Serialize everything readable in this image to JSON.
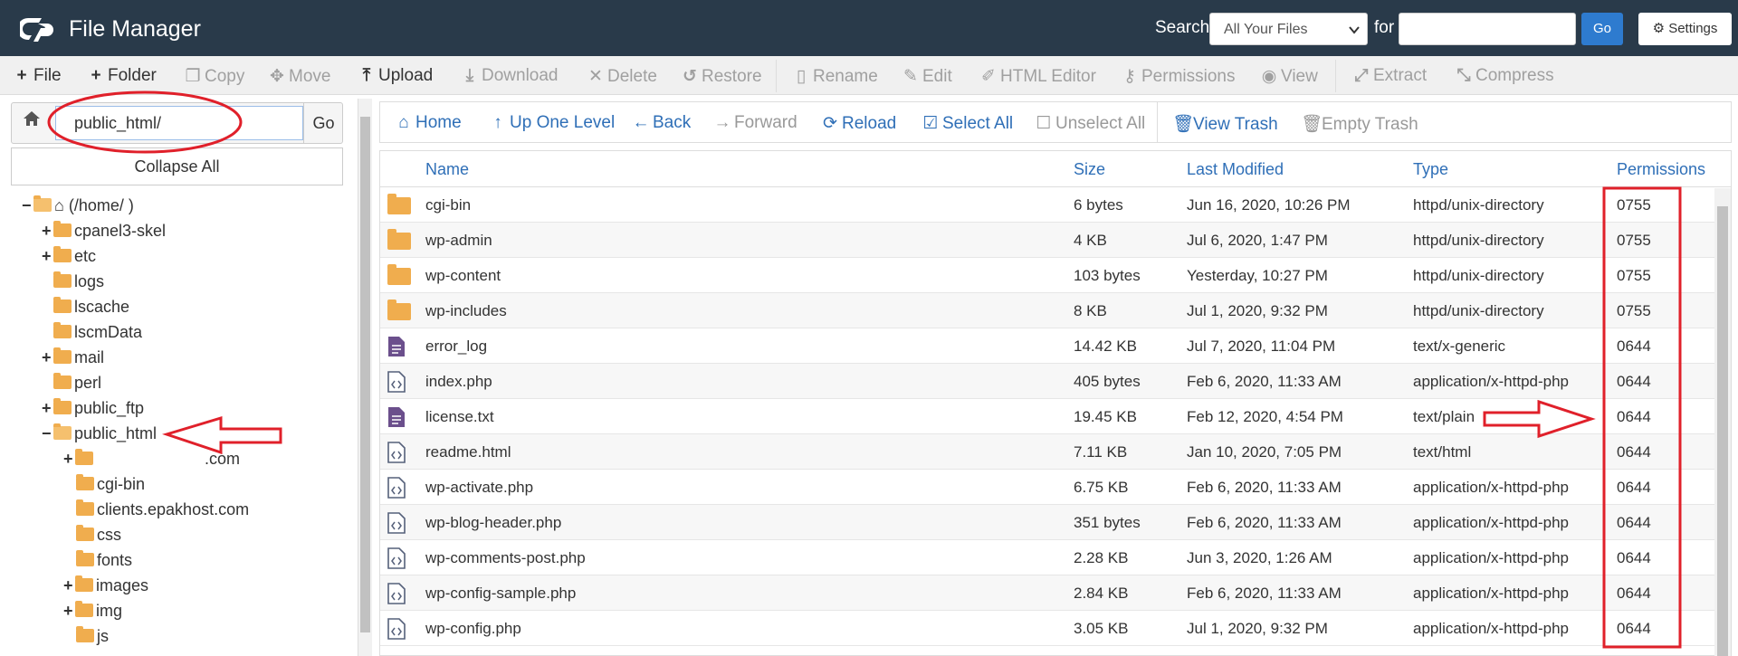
{
  "header": {
    "app_title": "File Manager",
    "search_label": "Search",
    "search_scope": "All Your Files",
    "for_label": "for",
    "search_value": "",
    "go_label": "Go",
    "settings_label": "Settings"
  },
  "toolbar": {
    "file": "File",
    "folder": "Folder",
    "copy": "Copy",
    "move": "Move",
    "upload": "Upload",
    "download": "Download",
    "delete": "Delete",
    "restore": "Restore",
    "rename": "Rename",
    "edit": "Edit",
    "html_editor": "HTML Editor",
    "permissions": "Permissions",
    "view": "View",
    "extract": "Extract",
    "compress": "Compress"
  },
  "path": {
    "value": "public_html/",
    "go_label": "Go",
    "collapse_all": "Collapse All"
  },
  "tree": {
    "root": "(/home/               )",
    "items": [
      "cpanel3-skel",
      "etc",
      "logs",
      "lscache",
      "lscmData",
      "mail",
      "perl",
      "public_ftp",
      "public_html"
    ],
    "children": [
      ".com",
      "cgi-bin",
      "clients.epakhost.com",
      "css",
      "fonts",
      "images",
      "img",
      "js"
    ]
  },
  "nav": {
    "home": "Home",
    "up": "Up One Level",
    "back": "Back",
    "forward": "Forward",
    "reload": "Reload",
    "select_all": "Select All",
    "unselect_all": "Unselect All",
    "view_trash": "View Trash",
    "empty_trash": "Empty Trash"
  },
  "table": {
    "columns": [
      "Name",
      "Size",
      "Last Modified",
      "Type",
      "Permissions"
    ],
    "rows": [
      {
        "name": "cgi-bin",
        "size": "6 bytes",
        "modified": "Jun 16, 2020, 10:26 PM",
        "type": "httpd/unix-directory",
        "perms": "0755",
        "icon": "folder-icon"
      },
      {
        "name": "wp-admin",
        "size": "4 KB",
        "modified": "Jul 6, 2020, 1:47 PM",
        "type": "httpd/unix-directory",
        "perms": "0755",
        "icon": "folder-icon"
      },
      {
        "name": "wp-content",
        "size": "103 bytes",
        "modified": "Yesterday, 10:27 PM",
        "type": "httpd/unix-directory",
        "perms": "0755",
        "icon": "folder-icon"
      },
      {
        "name": "wp-includes",
        "size": "8 KB",
        "modified": "Jul 1, 2020, 9:32 PM",
        "type": "httpd/unix-directory",
        "perms": "0755",
        "icon": "folder-icon"
      },
      {
        "name": "error_log",
        "size": "14.42 KB",
        "modified": "Jul 7, 2020, 11:04 PM",
        "type": "text/x-generic",
        "perms": "0644",
        "icon": "text-file-icon"
      },
      {
        "name": "index.php",
        "size": "405 bytes",
        "modified": "Feb 6, 2020, 11:33 AM",
        "type": "application/x-httpd-php",
        "perms": "0644",
        "icon": "code-file-icon"
      },
      {
        "name": "license.txt",
        "size": "19.45 KB",
        "modified": "Feb 12, 2020, 4:54 PM",
        "type": "text/plain",
        "perms": "0644",
        "icon": "text-file-icon"
      },
      {
        "name": "readme.html",
        "size": "7.11 KB",
        "modified": "Jan 10, 2020, 7:05 PM",
        "type": "text/html",
        "perms": "0644",
        "icon": "code-file-icon"
      },
      {
        "name": "wp-activate.php",
        "size": "6.75 KB",
        "modified": "Feb 6, 2020, 11:33 AM",
        "type": "application/x-httpd-php",
        "perms": "0644",
        "icon": "code-file-icon"
      },
      {
        "name": "wp-blog-header.php",
        "size": "351 bytes",
        "modified": "Feb 6, 2020, 11:33 AM",
        "type": "application/x-httpd-php",
        "perms": "0644",
        "icon": "code-file-icon"
      },
      {
        "name": "wp-comments-post.php",
        "size": "2.28 KB",
        "modified": "Jun 3, 2020, 1:26 AM",
        "type": "application/x-httpd-php",
        "perms": "0644",
        "icon": "code-file-icon"
      },
      {
        "name": "wp-config-sample.php",
        "size": "2.84 KB",
        "modified": "Feb 6, 2020, 11:33 AM",
        "type": "application/x-httpd-php",
        "perms": "0644",
        "icon": "code-file-icon"
      },
      {
        "name": "wp-config.php",
        "size": "3.05 KB",
        "modified": "Jul 1, 2020, 9:32 PM",
        "type": "application/x-httpd-php",
        "perms": "0644",
        "icon": "code-file-icon"
      }
    ]
  },
  "colors": {
    "header_bg": "#293a4a",
    "link_blue": "#2f6fb7",
    "annotation_red": "#e0202a"
  }
}
